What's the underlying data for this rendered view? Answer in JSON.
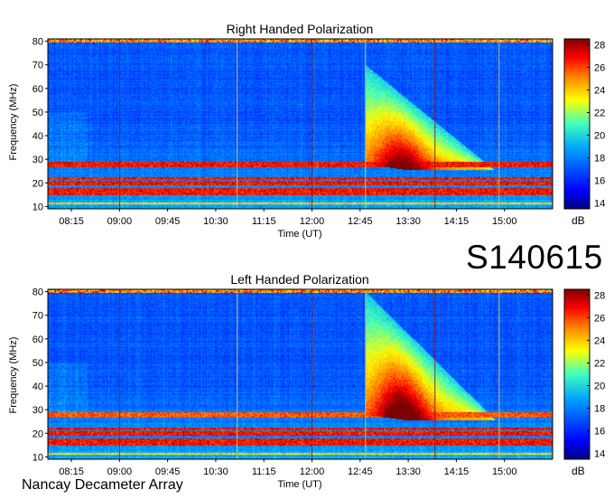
{
  "observation_id": "S140615",
  "instrument": "Nancay Decameter Array",
  "chart_data": [
    {
      "type": "heatmap",
      "title": "Right Handed Polarization",
      "xlabel": "Time (UT)",
      "ylabel": "Frequency (MHz)",
      "x_ticks": [
        "08:15",
        "09:00",
        "09:45",
        "10:30",
        "11:15",
        "12:00",
        "12:45",
        "13:30",
        "14:15",
        "15:00"
      ],
      "x_range": [
        "07:53",
        "15:45"
      ],
      "y_ticks": [
        10,
        20,
        30,
        40,
        50,
        60,
        70,
        80
      ],
      "ylim": [
        9,
        81
      ],
      "colorbar_label": "dB",
      "colorbar_ticks": [
        14,
        16,
        18,
        20,
        22,
        24,
        26,
        28
      ],
      "colorbar_range": [
        13.5,
        28.5
      ],
      "background_level_db": 17,
      "interference_bands": [
        {
          "freq_mhz": [
            27,
            29
          ],
          "level_db": 27
        },
        {
          "freq_mhz": [
            21.5,
            22.5
          ],
          "level_db": 27
        },
        {
          "freq_mhz": [
            19,
            21
          ],
          "level_db": 27
        },
        {
          "freq_mhz": [
            15,
            18
          ],
          "level_db": 27
        },
        {
          "freq_mhz": [
            11,
            12
          ],
          "level_db": 24
        }
      ],
      "emission_event": {
        "start": "12:50",
        "peak": "13:25",
        "end": "15:00",
        "max_freq_mhz": 70,
        "peak_level_db": 27
      }
    },
    {
      "type": "heatmap",
      "title": "Left Handed Polarization",
      "xlabel": "Time (UT)",
      "ylabel": "Frequency (MHz)",
      "x_ticks": [
        "08:15",
        "09:00",
        "09:45",
        "10:30",
        "11:15",
        "12:00",
        "12:45",
        "13:30",
        "14:15",
        "15:00"
      ],
      "x_range": [
        "07:53",
        "15:45"
      ],
      "y_ticks": [
        10,
        20,
        30,
        40,
        50,
        60,
        70,
        80
      ],
      "ylim": [
        9,
        81
      ],
      "colorbar_label": "dB",
      "colorbar_ticks": [
        14,
        16,
        18,
        20,
        22,
        24,
        26,
        28
      ],
      "colorbar_range": [
        13.5,
        28.5
      ],
      "background_level_db": 17,
      "interference_bands": [
        {
          "freq_mhz": [
            27,
            29
          ],
          "level_db": 26
        },
        {
          "freq_mhz": [
            21.5,
            22.5
          ],
          "level_db": 27
        },
        {
          "freq_mhz": [
            19,
            21
          ],
          "level_db": 27
        },
        {
          "freq_mhz": [
            15,
            18
          ],
          "level_db": 27
        },
        {
          "freq_mhz": [
            11,
            12
          ],
          "level_db": 24
        }
      ],
      "emission_event": {
        "start": "12:50",
        "peak": "13:25",
        "end": "15:00",
        "max_freq_mhz": 80,
        "peak_level_db": 28
      }
    }
  ]
}
